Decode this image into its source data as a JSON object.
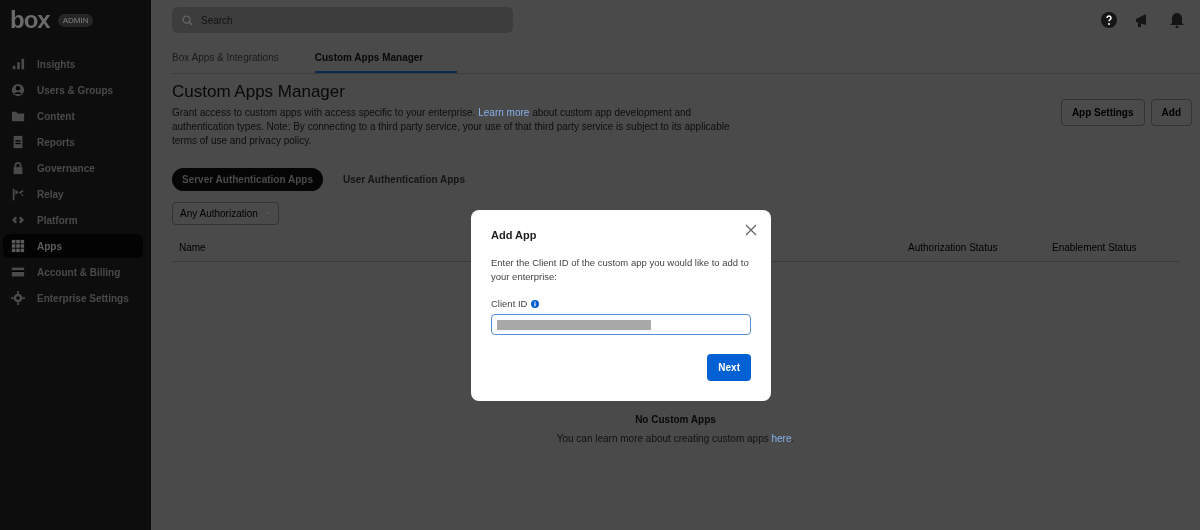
{
  "sidebar": {
    "logo": "box",
    "badge": "ADMIN",
    "items": [
      {
        "label": "Insights",
        "selected": false
      },
      {
        "label": "Users & Groups",
        "selected": false
      },
      {
        "label": "Content",
        "selected": false
      },
      {
        "label": "Reports",
        "selected": false
      },
      {
        "label": "Governance",
        "selected": false
      },
      {
        "label": "Relay",
        "selected": false
      },
      {
        "label": "Platform",
        "selected": false
      },
      {
        "label": "Apps",
        "selected": true
      },
      {
        "label": "Account & Billing",
        "selected": false
      },
      {
        "label": "Enterprise Settings",
        "selected": false
      }
    ]
  },
  "search": {
    "placeholder": "Search"
  },
  "tabs": [
    {
      "label": "Box Apps & Integrations",
      "selected": false
    },
    {
      "label": "Custom Apps Manager",
      "selected": true
    }
  ],
  "page": {
    "title": "Custom Apps Manager",
    "description_before": "Grant access to custom apps with access specific to your enterprise. ",
    "link": "Learn more",
    "description_after": " about custom app development and authentication types. Note: By connecting to a third party service, your use of that third party service is subject to its applicable terms of use and privacy policy.",
    "buttons": [
      "App Settings",
      "Add"
    ]
  },
  "app_tabs": [
    {
      "label": "Server Authentication Apps",
      "selected": true
    },
    {
      "label": "User Authentication Apps",
      "selected": false
    }
  ],
  "filter": {
    "label": "Any Authorization"
  },
  "table": {
    "columns": [
      "Name",
      "Authorization Status",
      "Enablement Status"
    ]
  },
  "empty_state": {
    "title": "No Custom Apps",
    "text": "You can learn more about creating custom apps ",
    "link": "here",
    "end": "."
  },
  "modal": {
    "title": "Add App",
    "text": "Enter the Client ID of the custom app you would like to add to your enterprise:",
    "field_label": "Client ID",
    "field_redacted": true,
    "button": "Next"
  }
}
